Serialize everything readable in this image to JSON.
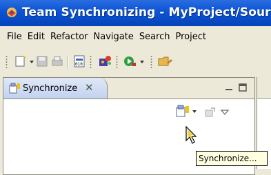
{
  "window": {
    "title": "Team Synchronizing - MyProject/Source"
  },
  "menubar": {
    "items": [
      "File",
      "Edit",
      "Refactor",
      "Navigate",
      "Search",
      "Project"
    ]
  },
  "toolbar": {
    "icons": [
      "new-wizard-icon",
      "save-icon",
      "print-icon",
      "binary-icon",
      "paint-icon",
      "run-icon",
      "open-folder-icon"
    ]
  },
  "view": {
    "tab_label": "Synchronize",
    "tooltip": "Synchronize..."
  },
  "colors": {
    "titlebar": "#0a53d4",
    "chrome": "#ece9d8",
    "tab_active": "#c2d2ee",
    "tooltip_bg": "#ffffe1"
  }
}
